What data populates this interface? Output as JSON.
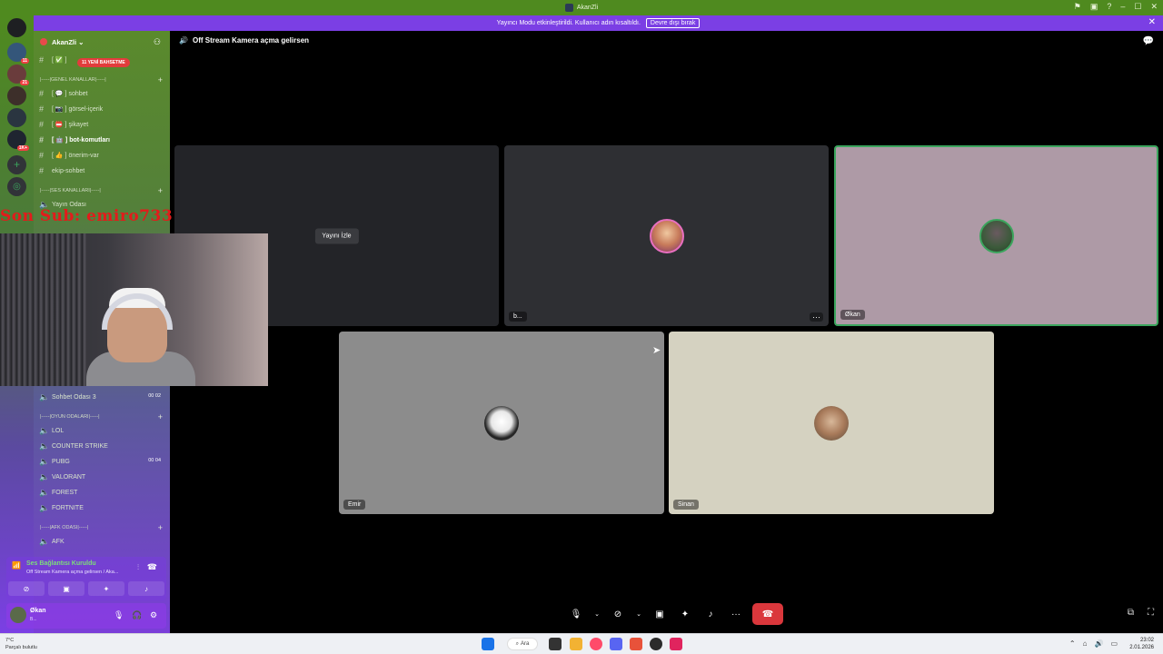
{
  "window": {
    "title": "AkanZli"
  },
  "banner": {
    "text": "Yayıncı Modu etkinleştirildi. Kullanıcı adın kısaltıldı.",
    "button": "Devre dışı bırak"
  },
  "server": {
    "name": "AkanZli"
  },
  "sidebar": {
    "new_pill": "11 YENİ BAHSETME",
    "items": [
      {
        "label": "[ 💬 ] sohbet"
      },
      {
        "label": "[ 📷 ] görsel-içerik"
      },
      {
        "label": "[ 📛 ] şikayet"
      },
      {
        "label": "[ 🤖 ] bot-komutları"
      },
      {
        "label": "[ 👍 ] önerim-var"
      },
      {
        "label": "ekip-sohbet"
      }
    ],
    "categories": {
      "general": "|-----|GENEL KANALLAR|-----|",
      "voice": "|-----|SES KANALLARI|-----|",
      "games": "|-----|OYUN ODALARI|-----|",
      "afk": "|-----|AFK ODASI|-----|"
    },
    "voice_channels": [
      {
        "label": "Yayın Odası",
        "counts": ""
      },
      {
        "label": "Sohbet Odası 3",
        "counts": "00  02"
      },
      {
        "label": "LOL",
        "counts": ""
      },
      {
        "label": "COUNTER STRIKE",
        "counts": ""
      },
      {
        "label": "PUBG",
        "counts": "00  04"
      },
      {
        "label": "VALORANT",
        "counts": ""
      },
      {
        "label": "FOREST",
        "counts": ""
      },
      {
        "label": "FORTNITE",
        "counts": ""
      },
      {
        "label": "AFK",
        "counts": ""
      }
    ]
  },
  "voice_panel": {
    "title": "Ses Bağlantısı Kuruldu",
    "subtitle": "Off Stream Kamera açma gelirsen / Aka..."
  },
  "user_panel": {
    "name": "Økan",
    "status": "B..."
  },
  "overlay": {
    "sub_text": "Son Sub: emiro733"
  },
  "main": {
    "channel_title": "Off Stream Kamera açma gelirsen",
    "tiles": [
      {
        "name": "",
        "watch": "Yayını İzle"
      },
      {
        "name": "b..."
      },
      {
        "name": "Økan"
      },
      {
        "name": "Emir"
      },
      {
        "name": "Sinan"
      }
    ]
  },
  "taskbar": {
    "weather_temp": "7°C",
    "weather_text": "Parçalı bulutlu",
    "search": "Ara",
    "time": "23:02",
    "date": "2.01.2026"
  },
  "colors": {
    "accent": "#7b3fe4",
    "speaking": "#3ba55d",
    "hangup": "#da373c",
    "mention": "#e23c3c"
  }
}
